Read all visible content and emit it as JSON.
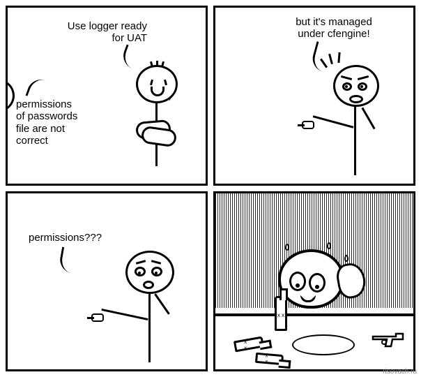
{
  "panels": {
    "p1": {
      "text_top": "Use logger ready\nfor UAT",
      "text_bottom": "permissions\nof passwords\nfile are not\ncorrect"
    },
    "p2": {
      "text": "but it's managed\nunder cfengine!"
    },
    "p3": {
      "text": "permissions???"
    }
  },
  "watermark": "risovach.ru"
}
